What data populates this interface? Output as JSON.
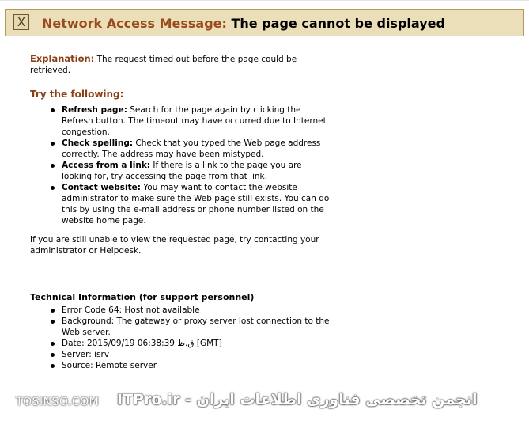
{
  "banner": {
    "icon": "close-x-icon",
    "icon_glyph": "X",
    "label": "Network Access Message:",
    "message": "The page cannot be displayed"
  },
  "explanation": {
    "label": "Explanation:",
    "text": "The request timed out before the page could be retrieved."
  },
  "try": {
    "heading": "Try the following:",
    "items": [
      {
        "title": "Refresh page:",
        "text": "Search for the page again by clicking the Refresh button. The timeout may have occurred due to Internet congestion."
      },
      {
        "title": "Check spelling:",
        "text": "Check that you typed the Web page address correctly. The address may have been mistyped."
      },
      {
        "title": "Access from a link:",
        "text": "If there is a link to the page you are looking for, try accessing the page from that link."
      },
      {
        "title": "Contact website:",
        "text": "You may want to contact the website administrator to make sure the Web page still exists. You can do this by using the e-mail address or phone number listed on the website home page."
      }
    ]
  },
  "contact_text": "If you are still unable to view the requested page, try contacting your administrator or Helpdesk.",
  "technical": {
    "heading": "Technical Information (for support personnel)",
    "items": [
      "Error Code 64: Host not available",
      "Background: The gateway or proxy server lost connection to the Web server.",
      "Date: 2015/09/19 06:38:39 ق.ظ [GMT]",
      "Server: isrv",
      "Source: Remote server"
    ]
  },
  "watermark": {
    "left": "TOSINSO.COM",
    "right": "ITPro.ir - انجمن تخصصی فناوری اطلاعات ایران"
  }
}
